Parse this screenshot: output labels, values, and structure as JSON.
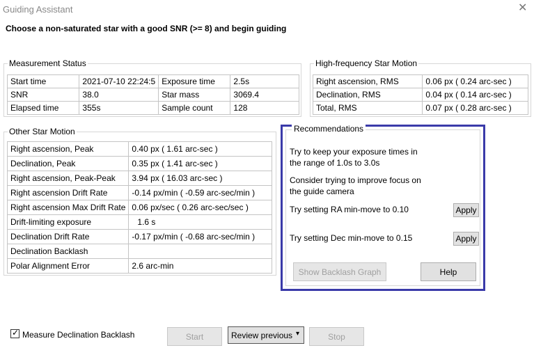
{
  "window": {
    "title": "Guiding Assistant",
    "close_glyph": "✕"
  },
  "instruction": "Choose a non-saturated star with a good SNR (>= 8) and begin guiding",
  "measurement_status": {
    "legend": "Measurement Status",
    "rows": [
      [
        "Start time",
        "2021-07-10 22:24:5",
        "Exposure time",
        "2.5s"
      ],
      [
        "SNR",
        "38.0",
        "Star mass",
        "3069.4"
      ],
      [
        "Elapsed time",
        "355s",
        "Sample count",
        "128"
      ]
    ]
  },
  "high_frequency": {
    "legend": "High-frequency Star Motion",
    "rows": [
      [
        "Right ascension, RMS",
        "0.06 px (  0.24 arc-sec )"
      ],
      [
        "Declination, RMS",
        "0.04 px (  0.14 arc-sec )"
      ],
      [
        "Total, RMS",
        "0.07 px (  0.28 arc-sec )"
      ]
    ]
  },
  "other_motion": {
    "legend": "Other Star Motion",
    "rows": [
      [
        "Right ascension, Peak",
        "0.40 px (  1.61 arc-sec )"
      ],
      [
        "Declination, Peak",
        "0.35 px (  1.41 arc-sec )"
      ],
      [
        "Right ascension, Peak-Peak",
        "3.94 px ( 16.03 arc-sec )"
      ],
      [
        "Right ascension Drift Rate",
        "-0.14 px/min ( -0.59 arc-sec/min )"
      ],
      [
        "Right ascension Max Drift Rate",
        "0.06 px/sec (  0.26 arc-sec/sec )"
      ],
      [
        "Drift-limiting exposure",
        "1.6 s"
      ],
      [
        "Declination Drift Rate",
        "-0.17 px/min ( -0.68 arc-sec/min )"
      ],
      [
        "Declination Backlash",
        ""
      ],
      [
        "Polar Alignment Error",
        "2.6 arc-min"
      ]
    ]
  },
  "recommendations": {
    "legend": "Recommendations",
    "exposure_line1": "Try to keep your exposure times in",
    "exposure_line2": "the range of 1.0s to 3.0s",
    "focus_line1": "Consider trying to improve focus on",
    "focus_line2": "the guide camera",
    "ra_text": "Try setting RA min-move to 0.10",
    "dec_text": "Try setting Dec min-move to 0.15",
    "apply_label": "Apply",
    "backlash_button": "Show Backlash Graph",
    "help_button": "Help"
  },
  "footer": {
    "checkbox_label": "Measure Declination Backlash",
    "checkbox_checked": true,
    "start_button": "Start",
    "review_button": "Review previous",
    "review_arrow": "▾",
    "stop_button": "Stop"
  },
  "colors": {
    "highlight_border": "#3a3aa9"
  }
}
